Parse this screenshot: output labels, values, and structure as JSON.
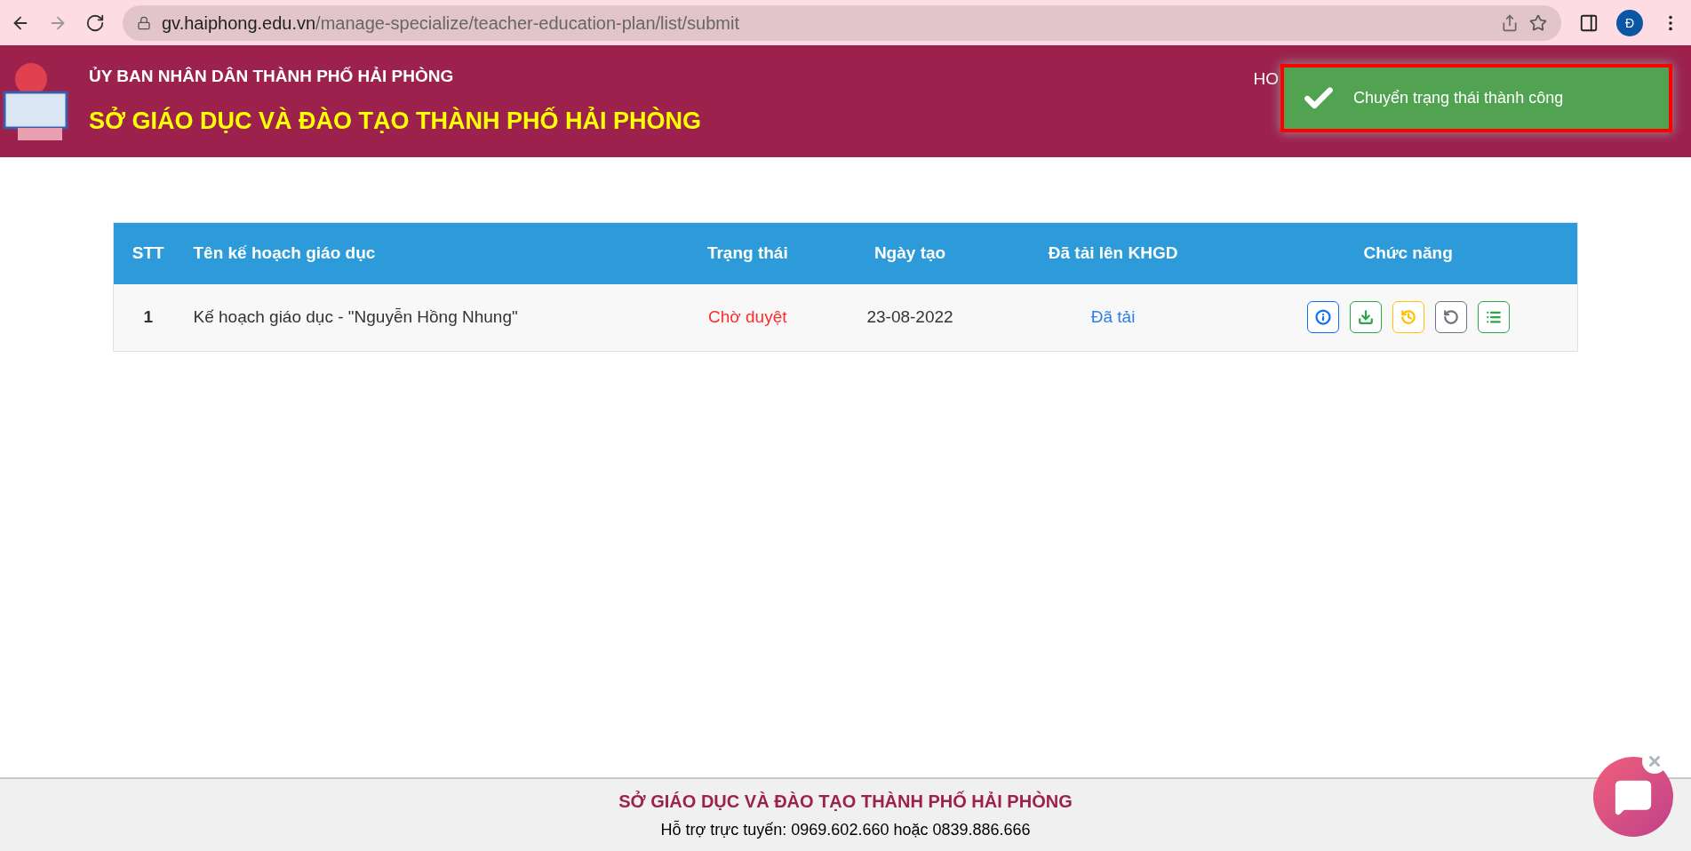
{
  "browser": {
    "url_host": "gv.haiphong.edu.vn",
    "url_path": "/manage-specialize/teacher-education-plan/list/submit",
    "profile_initial": "Đ"
  },
  "header": {
    "subtitle": "ỦY BAN NHÂN DÂN THÀNH PHỐ HẢI PHÒNG",
    "title": "SỞ GIÁO DỤC VÀ ĐÀO TẠO THÀNH PHỐ HẢI PHÒNG",
    "nav_partial": "HO"
  },
  "toast": {
    "message": "Chuyển trạng thái thành công"
  },
  "table": {
    "columns": [
      "STT",
      "Tên kế hoạch giáo dục",
      "Trạng thái",
      "Ngày tạo",
      "Đã tải lên KHGD",
      "Chức năng"
    ],
    "rows": [
      {
        "stt": "1",
        "name": "Kế hoạch giáo dục - \"Nguyễn Hồng Nhung\"",
        "status": "Chờ duyệt",
        "date": "23-08-2022",
        "uploaded": "Đã tải",
        "actions": [
          {
            "kind": "info"
          },
          {
            "kind": "download"
          },
          {
            "kind": "history"
          },
          {
            "kind": "undo"
          },
          {
            "kind": "list"
          }
        ]
      }
    ]
  },
  "footer": {
    "title": "SỞ GIÁO DỤC VÀ ĐÀO TẠO THÀNH PHỐ HẢI PHÒNG",
    "support": "Hỗ trợ trực tuyến: 0969.602.660 hoặc 0839.886.666"
  }
}
